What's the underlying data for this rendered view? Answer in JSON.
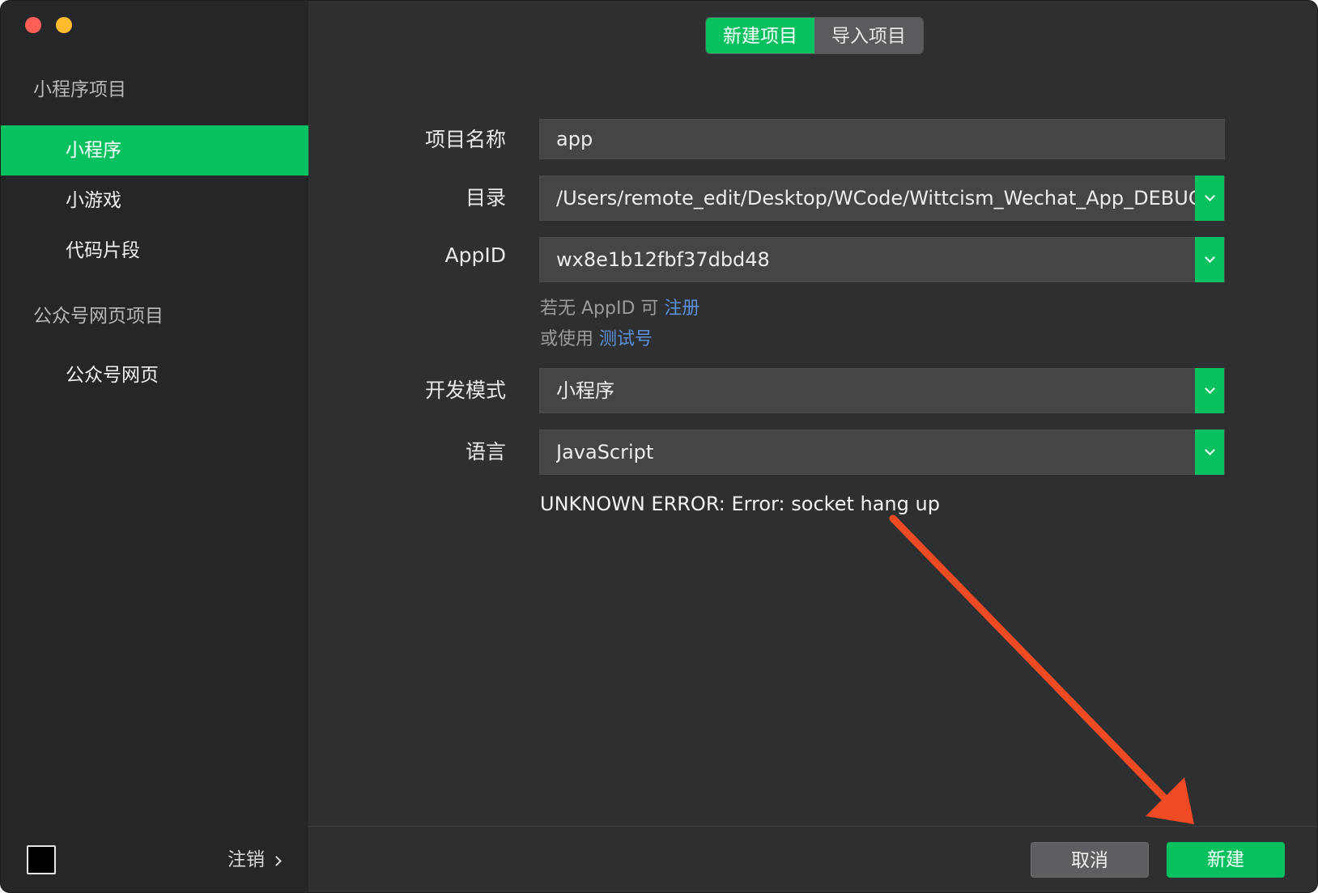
{
  "sidebar": {
    "section_miniprogram": "小程序项目",
    "items": [
      {
        "label": "小程序"
      },
      {
        "label": "小游戏"
      },
      {
        "label": "代码片段"
      }
    ],
    "section_official": "公众号网页项目",
    "official_items": [
      {
        "label": "公众号网页"
      }
    ],
    "logout_label": "注销"
  },
  "tabs": {
    "new_project": "新建项目",
    "import_project": "导入项目"
  },
  "form": {
    "name_label": "项目名称",
    "name_value": "app",
    "dir_label": "目录",
    "dir_value": "/Users/remote_edit/Desktop/WCode/Wittcism_Wechat_App_DEBUG_",
    "appid_label": "AppID",
    "appid_value": "wx8e1b12fbf37dbd48",
    "hint_line1_prefix": "若无 AppID 可 ",
    "hint_register": "注册",
    "hint_line2_prefix": "或使用 ",
    "hint_test_account": "测试号",
    "mode_label": "开发模式",
    "mode_value": "小程序",
    "lang_label": "语言",
    "lang_value": "JavaScript",
    "error_text": "UNKNOWN ERROR: Error: socket hang up"
  },
  "footer": {
    "cancel_label": "取消",
    "create_label": "新建"
  },
  "colors": {
    "accent": "#07c160",
    "annotation_arrow": "#ee4a24",
    "link": "#5d8fd6"
  }
}
